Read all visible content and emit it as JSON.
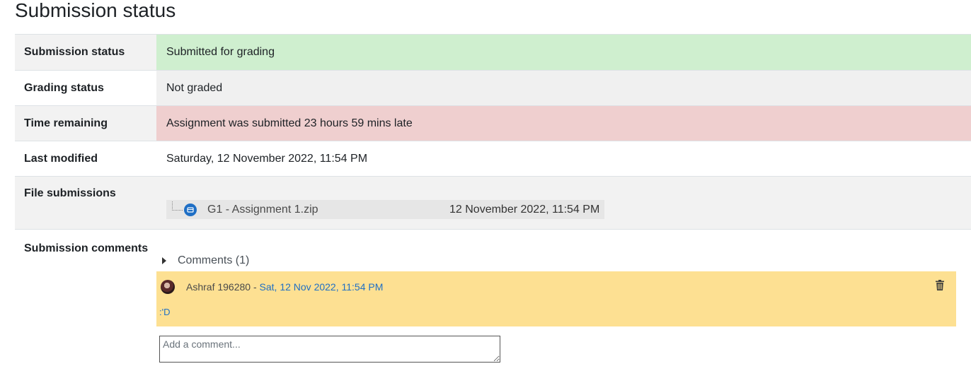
{
  "page_title": "Submission status",
  "rows": {
    "submission_status": {
      "label": "Submission status",
      "value": "Submitted for grading"
    },
    "grading_status": {
      "label": "Grading status",
      "value": "Not graded"
    },
    "time_remaining": {
      "label": "Time remaining",
      "value": "Assignment was submitted 23 hours 59 mins late"
    },
    "last_modified": {
      "label": "Last modified",
      "value": "Saturday, 12 November 2022, 11:54 PM"
    },
    "file_submissions": {
      "label": "File submissions",
      "file": {
        "name": "G1 - Assignment 1.zip",
        "date": "12 November 2022, 11:54 PM",
        "icon": "archive-icon"
      }
    },
    "submission_comments": {
      "label": "Submission comments",
      "toggle_label": "Comments (1)",
      "comments": [
        {
          "author": "Ashraf 196280",
          "separator": " - ",
          "when": "Sat, 12 Nov 2022, 11:54 PM",
          "text": ":'D"
        }
      ],
      "input_placeholder": "Add a comment..."
    }
  },
  "colors": {
    "submitted_bg": "#cfefcf",
    "late_bg": "#efcfcf",
    "comment_bg": "#fde092",
    "link": "#1f6fc5"
  }
}
